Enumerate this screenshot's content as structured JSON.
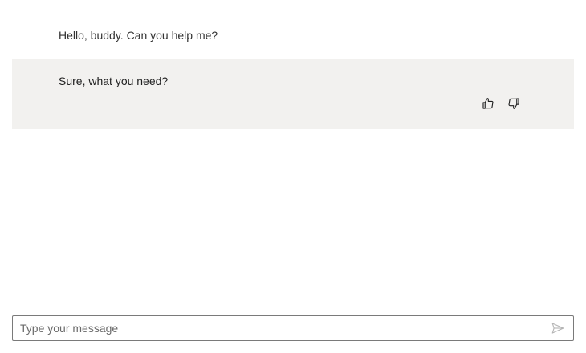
{
  "messages": [
    {
      "role": "user",
      "text": "Hello, buddy. Can you help me?"
    },
    {
      "role": "assistant",
      "text": "Sure, what you need?"
    }
  ],
  "feedback": {
    "like_icon": "thumbs-up-icon",
    "dislike_icon": "thumbs-down-icon"
  },
  "composer": {
    "placeholder": "Type your message",
    "value": "",
    "send_icon": "send-icon"
  },
  "colors": {
    "assistant_bubble_bg": "#f2f1ef",
    "composer_border": "#7a7a7a",
    "icon": "#1f1f1f",
    "send_icon": "#b5b5b5"
  }
}
